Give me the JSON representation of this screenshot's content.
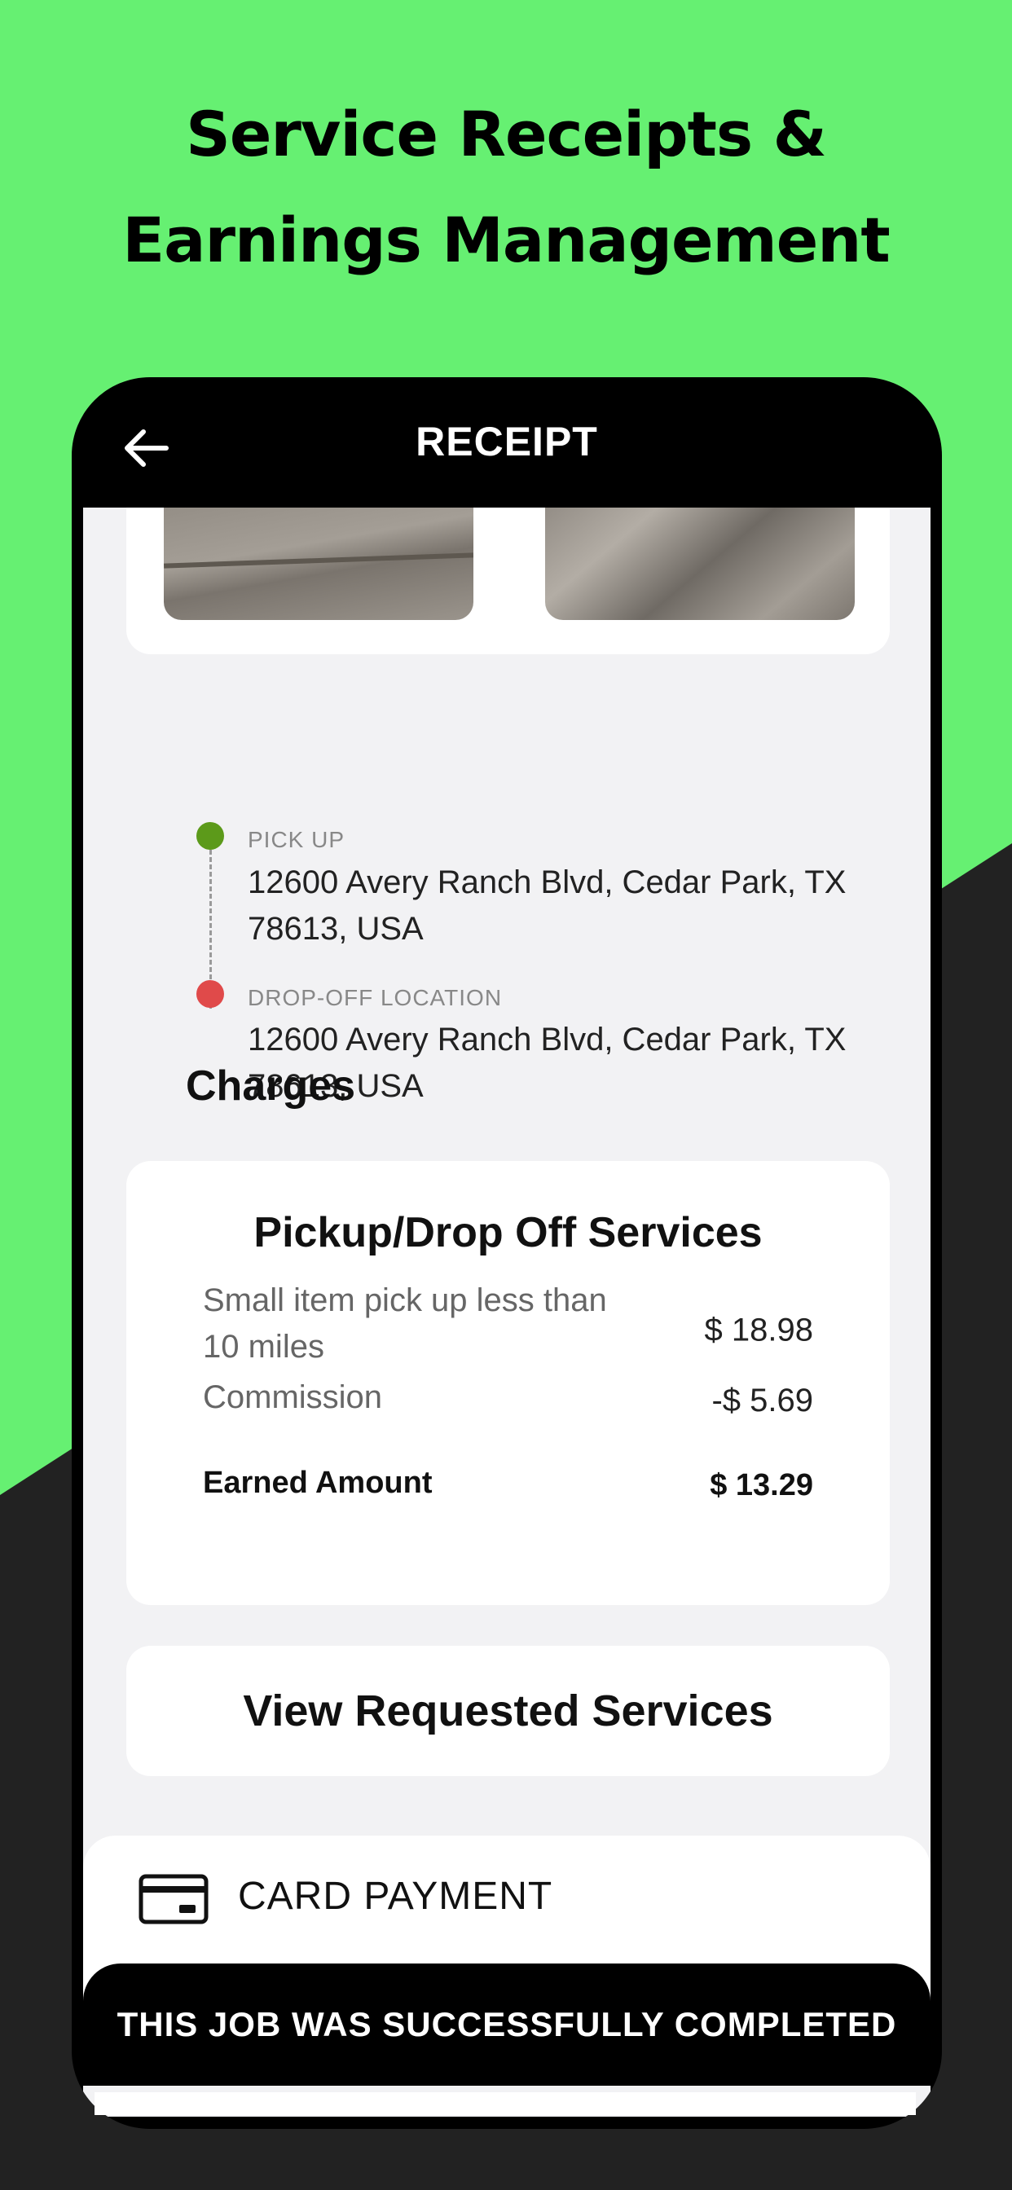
{
  "headline": {
    "line1": "Service Receipts &",
    "line2": "Earnings Management"
  },
  "colors": {
    "brand_green": "#66f072",
    "dark_bg": "#222222",
    "pickup_dot": "#5c9a1a",
    "dropoff_dot": "#e04a4a"
  },
  "navbar": {
    "title": "RECEIPT",
    "back_icon": "arrow-left-icon"
  },
  "pickup": {
    "label": "PICK UP",
    "address": "12600 Avery Ranch Blvd,  Cedar Park,  TX 78613,  USA"
  },
  "dropoff": {
    "label": "DROP-OFF LOCATION",
    "address": "12600 Avery Ranch Blvd,  Cedar Park,  TX 78613,  USA"
  },
  "charges": {
    "section_title": "Charges",
    "card_title": "Pickup/Drop  Off Services",
    "rows": [
      {
        "label": "Small item pick up less than 10 miles",
        "value": "$ 18.98"
      },
      {
        "label": "Commission",
        "value": "-$ 5.69"
      },
      {
        "label": "Earned Amount",
        "value": "$ 13.29"
      }
    ]
  },
  "view_requested_services": "View Requested Services",
  "payment": {
    "icon": "credit-card-icon",
    "label": "CARD PAYMENT"
  },
  "status_bar": "THIS JOB WAS SUCCESSFULLY COMPLETED"
}
